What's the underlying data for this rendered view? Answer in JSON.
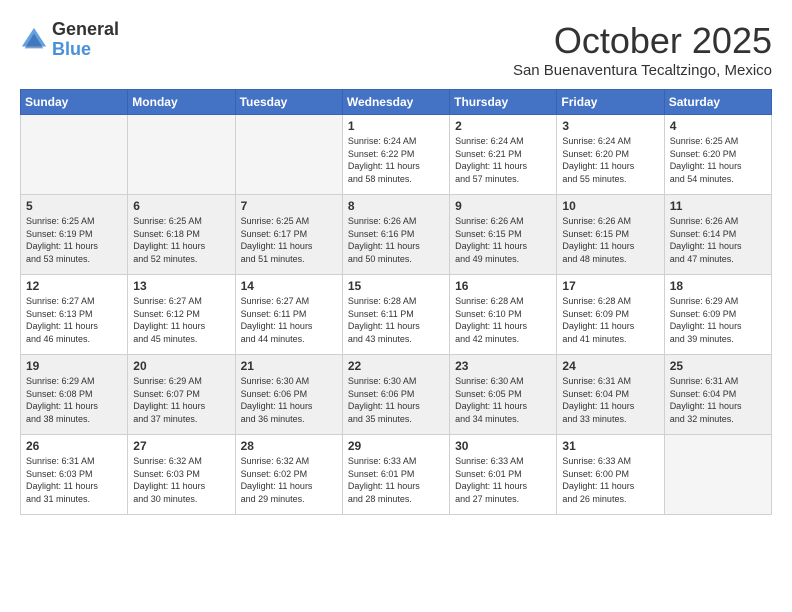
{
  "header": {
    "logo_general": "General",
    "logo_blue": "Blue",
    "title": "October 2025",
    "subtitle": "San Buenaventura Tecaltzingo, Mexico"
  },
  "days_of_week": [
    "Sunday",
    "Monday",
    "Tuesday",
    "Wednesday",
    "Thursday",
    "Friday",
    "Saturday"
  ],
  "weeks": [
    [
      {
        "day": "",
        "text": "",
        "empty": true
      },
      {
        "day": "",
        "text": "",
        "empty": true
      },
      {
        "day": "",
        "text": "",
        "empty": true
      },
      {
        "day": "1",
        "text": "Sunrise: 6:24 AM\nSunset: 6:22 PM\nDaylight: 11 hours\nand 58 minutes."
      },
      {
        "day": "2",
        "text": "Sunrise: 6:24 AM\nSunset: 6:21 PM\nDaylight: 11 hours\nand 57 minutes."
      },
      {
        "day": "3",
        "text": "Sunrise: 6:24 AM\nSunset: 6:20 PM\nDaylight: 11 hours\nand 55 minutes."
      },
      {
        "day": "4",
        "text": "Sunrise: 6:25 AM\nSunset: 6:20 PM\nDaylight: 11 hours\nand 54 minutes."
      }
    ],
    [
      {
        "day": "5",
        "text": "Sunrise: 6:25 AM\nSunset: 6:19 PM\nDaylight: 11 hours\nand 53 minutes.",
        "shaded": true
      },
      {
        "day": "6",
        "text": "Sunrise: 6:25 AM\nSunset: 6:18 PM\nDaylight: 11 hours\nand 52 minutes.",
        "shaded": true
      },
      {
        "day": "7",
        "text": "Sunrise: 6:25 AM\nSunset: 6:17 PM\nDaylight: 11 hours\nand 51 minutes.",
        "shaded": true
      },
      {
        "day": "8",
        "text": "Sunrise: 6:26 AM\nSunset: 6:16 PM\nDaylight: 11 hours\nand 50 minutes.",
        "shaded": true
      },
      {
        "day": "9",
        "text": "Sunrise: 6:26 AM\nSunset: 6:15 PM\nDaylight: 11 hours\nand 49 minutes.",
        "shaded": true
      },
      {
        "day": "10",
        "text": "Sunrise: 6:26 AM\nSunset: 6:15 PM\nDaylight: 11 hours\nand 48 minutes.",
        "shaded": true
      },
      {
        "day": "11",
        "text": "Sunrise: 6:26 AM\nSunset: 6:14 PM\nDaylight: 11 hours\nand 47 minutes.",
        "shaded": true
      }
    ],
    [
      {
        "day": "12",
        "text": "Sunrise: 6:27 AM\nSunset: 6:13 PM\nDaylight: 11 hours\nand 46 minutes."
      },
      {
        "day": "13",
        "text": "Sunrise: 6:27 AM\nSunset: 6:12 PM\nDaylight: 11 hours\nand 45 minutes."
      },
      {
        "day": "14",
        "text": "Sunrise: 6:27 AM\nSunset: 6:11 PM\nDaylight: 11 hours\nand 44 minutes."
      },
      {
        "day": "15",
        "text": "Sunrise: 6:28 AM\nSunset: 6:11 PM\nDaylight: 11 hours\nand 43 minutes."
      },
      {
        "day": "16",
        "text": "Sunrise: 6:28 AM\nSunset: 6:10 PM\nDaylight: 11 hours\nand 42 minutes."
      },
      {
        "day": "17",
        "text": "Sunrise: 6:28 AM\nSunset: 6:09 PM\nDaylight: 11 hours\nand 41 minutes."
      },
      {
        "day": "18",
        "text": "Sunrise: 6:29 AM\nSunset: 6:09 PM\nDaylight: 11 hours\nand 39 minutes."
      }
    ],
    [
      {
        "day": "19",
        "text": "Sunrise: 6:29 AM\nSunset: 6:08 PM\nDaylight: 11 hours\nand 38 minutes.",
        "shaded": true
      },
      {
        "day": "20",
        "text": "Sunrise: 6:29 AM\nSunset: 6:07 PM\nDaylight: 11 hours\nand 37 minutes.",
        "shaded": true
      },
      {
        "day": "21",
        "text": "Sunrise: 6:30 AM\nSunset: 6:06 PM\nDaylight: 11 hours\nand 36 minutes.",
        "shaded": true
      },
      {
        "day": "22",
        "text": "Sunrise: 6:30 AM\nSunset: 6:06 PM\nDaylight: 11 hours\nand 35 minutes.",
        "shaded": true
      },
      {
        "day": "23",
        "text": "Sunrise: 6:30 AM\nSunset: 6:05 PM\nDaylight: 11 hours\nand 34 minutes.",
        "shaded": true
      },
      {
        "day": "24",
        "text": "Sunrise: 6:31 AM\nSunset: 6:04 PM\nDaylight: 11 hours\nand 33 minutes.",
        "shaded": true
      },
      {
        "day": "25",
        "text": "Sunrise: 6:31 AM\nSunset: 6:04 PM\nDaylight: 11 hours\nand 32 minutes.",
        "shaded": true
      }
    ],
    [
      {
        "day": "26",
        "text": "Sunrise: 6:31 AM\nSunset: 6:03 PM\nDaylight: 11 hours\nand 31 minutes."
      },
      {
        "day": "27",
        "text": "Sunrise: 6:32 AM\nSunset: 6:03 PM\nDaylight: 11 hours\nand 30 minutes."
      },
      {
        "day": "28",
        "text": "Sunrise: 6:32 AM\nSunset: 6:02 PM\nDaylight: 11 hours\nand 29 minutes."
      },
      {
        "day": "29",
        "text": "Sunrise: 6:33 AM\nSunset: 6:01 PM\nDaylight: 11 hours\nand 28 minutes."
      },
      {
        "day": "30",
        "text": "Sunrise: 6:33 AM\nSunset: 6:01 PM\nDaylight: 11 hours\nand 27 minutes."
      },
      {
        "day": "31",
        "text": "Sunrise: 6:33 AM\nSunset: 6:00 PM\nDaylight: 11 hours\nand 26 minutes."
      },
      {
        "day": "",
        "text": "",
        "empty": true
      }
    ]
  ]
}
